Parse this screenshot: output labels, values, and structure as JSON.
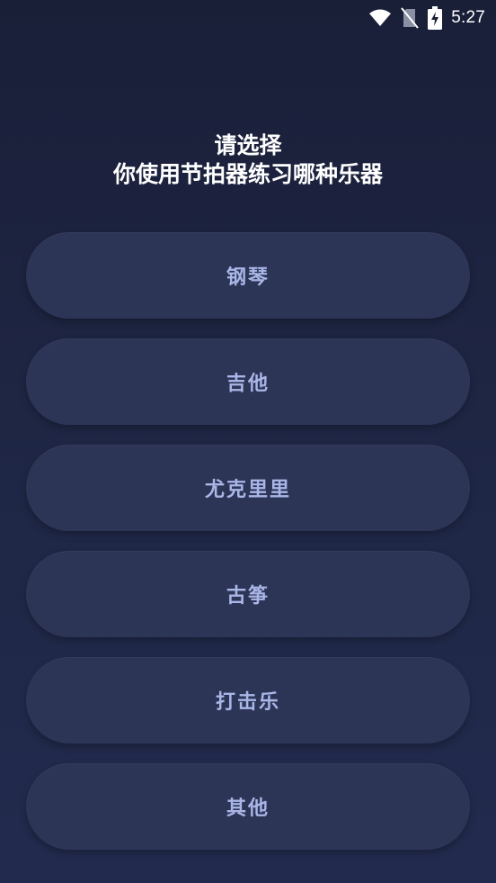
{
  "status_bar": {
    "time": "5:27",
    "icons": [
      "wifi-icon",
      "no-sim-icon",
      "battery-charging-icon"
    ]
  },
  "title": {
    "line1": "请选择",
    "line2": "你使用节拍器练习哪种乐器"
  },
  "choices": [
    {
      "label": "钢琴"
    },
    {
      "label": "吉他"
    },
    {
      "label": "尤克里里"
    },
    {
      "label": "古筝"
    },
    {
      "label": "打击乐"
    },
    {
      "label": "其他"
    }
  ],
  "colors": {
    "background": "#1f2746",
    "button": "#2d3557",
    "button_text": "#a9b6e6",
    "title_text": "#ffffff"
  }
}
